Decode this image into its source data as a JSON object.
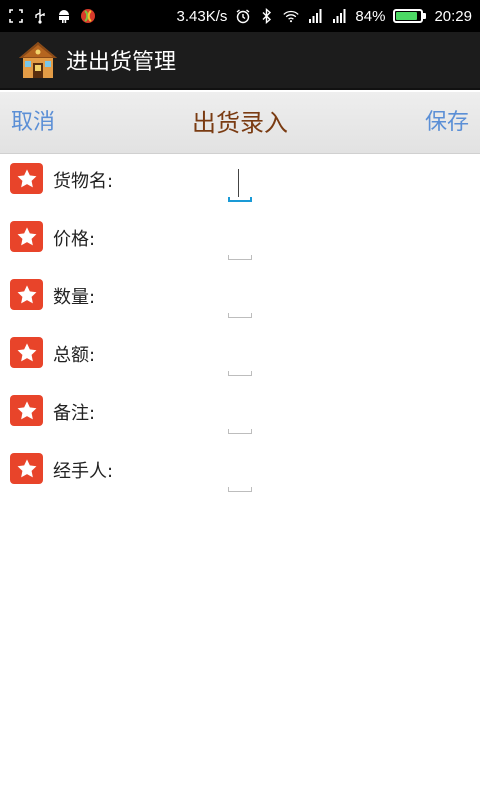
{
  "status_bar": {
    "network_speed": "3.43K/s",
    "battery_percent": "84%",
    "battery_level": 0.84,
    "time": "20:29",
    "icons": [
      "screenshot-icon",
      "usb-icon",
      "android-debug-icon",
      "app-notification-icon",
      "alarm-icon",
      "bluetooth-icon",
      "wifi-icon",
      "signal-icon",
      "signal-icon-2"
    ]
  },
  "action_bar": {
    "app_title": "进出货管理"
  },
  "sub_header": {
    "cancel_label": "取消",
    "title": "出货录入",
    "save_label": "保存"
  },
  "form": {
    "fields": [
      {
        "label": "货物名:",
        "value": ""
      },
      {
        "label": "价格:",
        "value": ""
      },
      {
        "label": "数量:",
        "value": ""
      },
      {
        "label": "总额:",
        "value": ""
      },
      {
        "label": "备注:",
        "value": ""
      },
      {
        "label": "经手人:",
        "value": ""
      }
    ]
  },
  "colors": {
    "accent_link": "#5b8fd6",
    "title_brown": "#7a3b12",
    "star_red": "#e8442a",
    "focus_blue": "#1a9ad6"
  }
}
